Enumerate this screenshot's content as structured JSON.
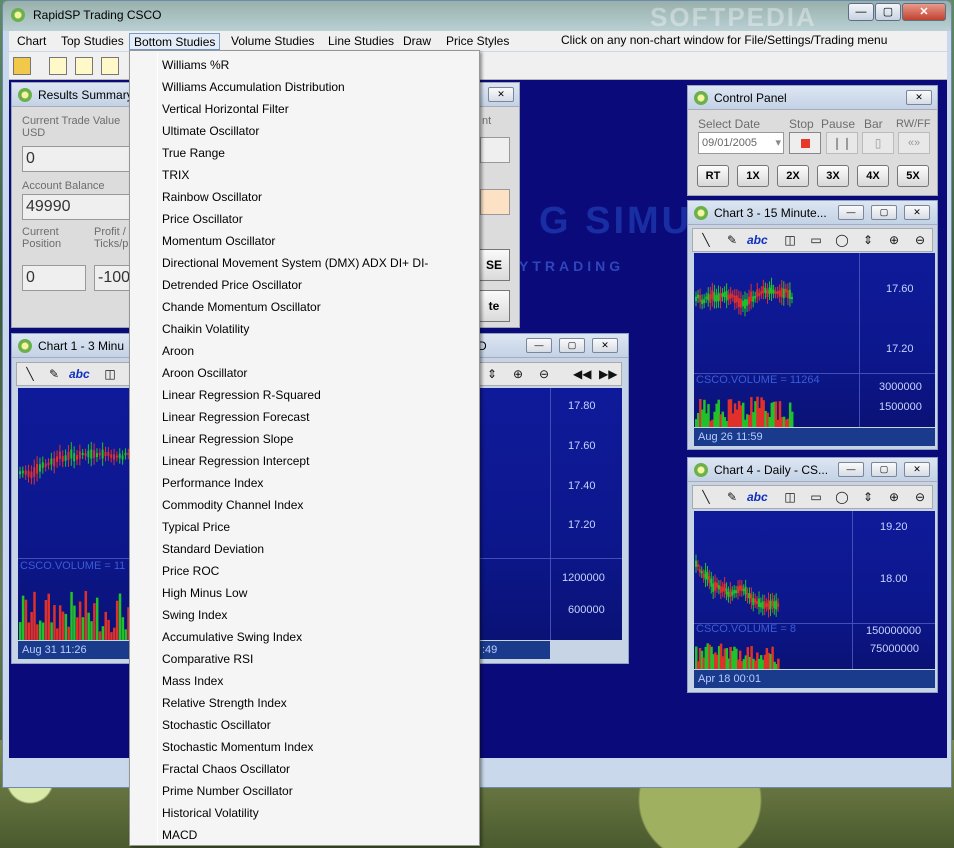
{
  "app": {
    "title": "RapidSP Trading CSCO",
    "window_controls": {
      "minimize": "—",
      "maximize": "▢",
      "close": "✕"
    }
  },
  "menu": {
    "items": [
      "Chart",
      "Top Studies",
      "Bottom Studies",
      "Volume Studies",
      "Line Studies",
      "Draw",
      "Price Styles"
    ],
    "active": "Bottom Studies",
    "hint": "Click on any non-chart window for File/Settings/Trading menu"
  },
  "watermark": {
    "softpedia": "SOFTPEDIA",
    "simulator": "G SIMULA",
    "daytrading": "YTRADING"
  },
  "results": {
    "title": "Results Summary",
    "current_trade_label": "Current Trade Value USD",
    "current_trade_value": "0",
    "account_balance_label": "Account Balance",
    "account_balance_value": "49990",
    "current_position_label": "Current Position",
    "current_position_value": "0",
    "profit_label": "Profit / Ticks/p",
    "profit_value": "-100",
    "partial_label": "nt",
    "btn1": "SE",
    "btn2": "te",
    "close": "✕"
  },
  "control_panel": {
    "title": "Control Panel",
    "select_date_label": "Select Date",
    "select_date_value": "09/01/2005",
    "stop_label": "Stop",
    "pause_label": "Pause",
    "bar_label": "Bar",
    "rwff_label": "RW/FF",
    "speeds": [
      "RT",
      "1X",
      "2X",
      "3X",
      "4X",
      "5X"
    ],
    "close": "✕"
  },
  "chart1": {
    "title": "Chart 1 - 3 Minu",
    "price_ticks": [
      "17.80",
      "17.60",
      "17.40",
      "17.20"
    ],
    "volume_label": "CSCO.VOLUME = 11",
    "volume_ticks": [
      "1200000",
      "600000"
    ],
    "status": "Aug 31 11:26",
    "status_right": ":49",
    "right_title": "D"
  },
  "chart3": {
    "title": "Chart 3 - 15 Minute...",
    "price_ticks": [
      "17.60",
      "17.20"
    ],
    "volume_label": "CSCO.VOLUME = 11264",
    "volume_ticks": [
      "3000000",
      "1500000"
    ],
    "status": "Aug 26 11:59"
  },
  "chart4": {
    "title": "Chart 4 - Daily - CS...",
    "price_ticks": [
      "19.20",
      "18.00"
    ],
    "volume_label": "CSCO.VOLUME = 8",
    "volume_ticks": [
      "150000000",
      "75000000"
    ],
    "status": "Apr 18 00:01"
  },
  "dropdown": {
    "items": [
      "Williams %R",
      "Williams Accumulation Distribution",
      "Vertical Horizontal Filter",
      "Ultimate Oscillator",
      "True Range",
      "TRIX",
      "Rainbow Oscillator",
      "Price Oscillator",
      "Momentum Oscillator",
      "Directional Movement System (DMX) ADX DI+ DI-",
      "Detrended Price Oscillator",
      "Chande Momentum Oscillator",
      "Chaikin Volatility",
      "Aroon",
      "Aroon Oscillator",
      "Linear Regression R-Squared",
      "Linear Regression Forecast",
      "Linear Regression Slope",
      "Linear Regression Intercept",
      "Performance Index",
      "Commodity Channel Index",
      "Typical Price",
      "Standard Deviation",
      "Price ROC",
      "High Minus Low",
      "Swing Index",
      "Accumulative Swing Index",
      "Comparative RSI",
      "Mass Index",
      "Relative Strength Index",
      "Stochastic Oscillator",
      "Stochastic Momentum Index",
      "Fractal Chaos Oscillator",
      "Prime Number Oscillator",
      "Historical Volatility",
      "MACD"
    ]
  },
  "colors": {
    "workspace": "#0a0a7a",
    "up_candle": "#21c12a",
    "down_candle": "#e0302a",
    "volume_up": "#21c12a",
    "volume_down": "#e0302a"
  }
}
